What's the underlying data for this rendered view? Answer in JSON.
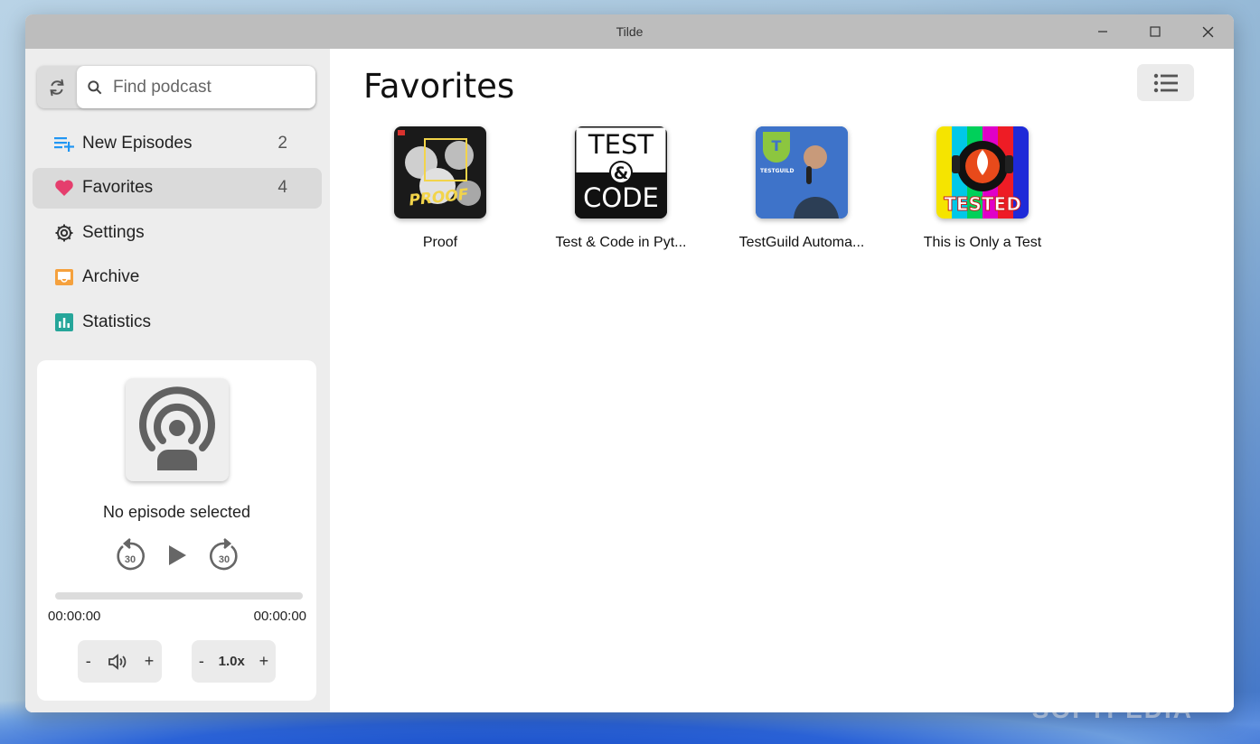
{
  "window": {
    "title": "Tilde"
  },
  "search": {
    "placeholder": "Find podcast"
  },
  "nav": {
    "items": [
      {
        "label": "New Episodes",
        "count": "2",
        "icon": "playlist-add-icon"
      },
      {
        "label": "Favorites",
        "count": "4",
        "icon": "heart-icon",
        "active": true
      },
      {
        "label": "Settings",
        "icon": "gear-icon"
      },
      {
        "label": "Archive",
        "icon": "inbox-icon"
      },
      {
        "label": "Statistics",
        "icon": "bar-chart-icon"
      }
    ]
  },
  "player": {
    "now_playing": "No episode selected",
    "elapsed": "00:00:00",
    "duration": "00:00:00",
    "skip_back_seconds": "30",
    "skip_forward_seconds": "30",
    "progress": 0,
    "volume_minus": "-",
    "volume_plus": "+",
    "speed_minus": "-",
    "speed_plus": "+",
    "speed": "1.0x"
  },
  "main": {
    "title": "Favorites",
    "podcasts": [
      {
        "title": "Proof",
        "cover_text": "PROOF"
      },
      {
        "title": "Test & Code in Pyt...",
        "cover_text_top": "TEST",
        "cover_text_mid": "&",
        "cover_text_bottom": "CODE"
      },
      {
        "title": "TestGuild Automa...",
        "cover_text": "TESTGUILD"
      },
      {
        "title": "This is Only a Test",
        "cover_text": "TESTED"
      }
    ]
  },
  "watermark": "SOFTPEDIA",
  "colors": {
    "accent_blue": "#2196f3",
    "heart": "#e53e6d",
    "archive": "#f5a13d",
    "statistics": "#26a69a",
    "sidebar_bg": "#ededed"
  }
}
